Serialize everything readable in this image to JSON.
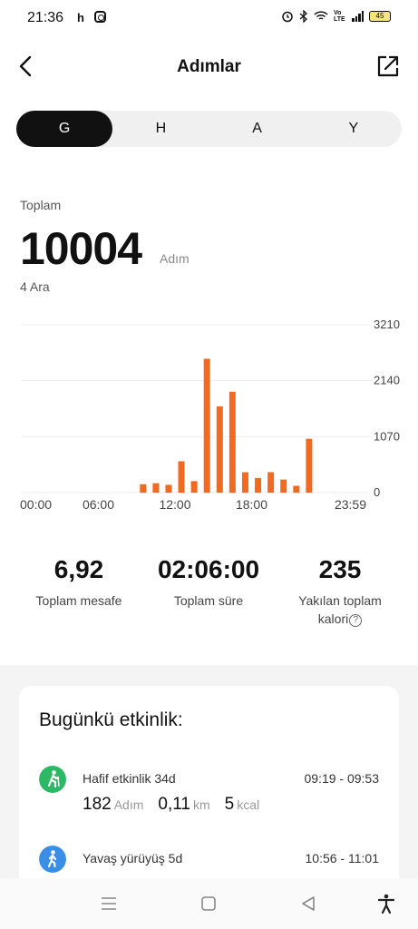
{
  "status_bar": {
    "time": "21:36",
    "notif_h": "h",
    "battery": "45",
    "net": "Vo LTE"
  },
  "header": {
    "title": "Adımlar"
  },
  "segments": [
    {
      "label": "G",
      "active": true
    },
    {
      "label": "H",
      "active": false
    },
    {
      "label": "A",
      "active": false
    },
    {
      "label": "Y",
      "active": false
    }
  ],
  "summary": {
    "label": "Toplam",
    "value": "10004",
    "unit": "Adım",
    "sub": "4 Ara"
  },
  "chart_data": {
    "type": "bar",
    "bar_color": "#f26a21",
    "x_ticks": [
      "00:00",
      "06:00",
      "12:00",
      "18:00",
      "23:59"
    ],
    "x_tick_hours": [
      0,
      6,
      12,
      18,
      24
    ],
    "y_ticks": [
      "3210",
      "2140",
      "1070",
      "0"
    ],
    "y_tick_values": [
      3210,
      2140,
      1070,
      0
    ],
    "ylim": [
      0,
      3210
    ],
    "xlim": [
      0,
      24
    ],
    "hours": [
      9,
      10,
      11,
      12,
      13,
      14,
      15,
      16,
      17,
      18,
      19,
      20,
      21
    ],
    "values": [
      160,
      180,
      150,
      600,
      220,
      2560,
      1650,
      1930,
      390,
      280,
      390,
      250,
      130
    ],
    "late_hour": 22,
    "late_value": 1030
  },
  "stats": [
    {
      "value": "6,92",
      "label": "Toplam mesafe"
    },
    {
      "value": "02:06:00",
      "label": "Toplam süre"
    },
    {
      "value": "235",
      "label_line1": "Yakılan toplam",
      "label_line2": "kalori"
    }
  ],
  "activity": {
    "title": "Bugünkü etkinlik:",
    "items": [
      {
        "name": "Hafif etkinlik 34d",
        "time": "09:19 - 09:53",
        "icon": "walking-light-icon",
        "color": "#2cb865",
        "steps": "182",
        "steps_unit": "Adım",
        "distance": "0,11",
        "distance_unit": "km",
        "calories": "5",
        "calories_unit": "kcal"
      },
      {
        "name": "Yavaş yürüyüş 5d",
        "time": "10:56 - 11:01",
        "icon": "walking-slow-icon",
        "color": "#3b8ee6"
      }
    ]
  },
  "nav": {
    "icons": [
      "menu-icon",
      "home-icon",
      "back-icon",
      "accessibility-icon"
    ]
  }
}
